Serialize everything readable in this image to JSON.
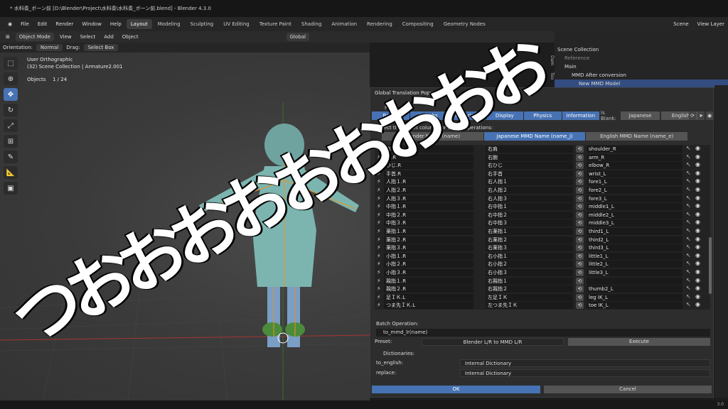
{
  "window": {
    "title": "* 水科奏_ボーン前 [D:\\Blender\\Project\\水科奏\\水科奏_ボーン前.blend] - Blender 4.3.0"
  },
  "menu": [
    "File",
    "Edit",
    "Render",
    "Window",
    "Help"
  ],
  "workspaces": [
    "Layout",
    "Modeling",
    "Sculpting",
    "UV Editing",
    "Texture Paint",
    "Shading",
    "Animation",
    "Rendering",
    "Compositing",
    "Geometry Nodes"
  ],
  "scene_label": "Scene",
  "view_layer": "View Layer",
  "header": {
    "mode": "Object Mode",
    "view": "View",
    "select": "Select",
    "add": "Add",
    "object": "Object",
    "transform": "Global"
  },
  "header2": {
    "orientation_label": "Orientation:",
    "orientation": "Normal",
    "drag_label": "Drag:",
    "drag": "Select Box"
  },
  "viewport": {
    "view_name": "User Orthographic",
    "collection": "(32) Scene Collection | Armature2.001",
    "objects_label": "Objects",
    "objects_count": "1 / 24"
  },
  "outliner": {
    "rows": [
      "Scene Collection",
      "Reference",
      "Main",
      "MMD After conversion",
      "New MMD Model"
    ]
  },
  "side_tabs": [
    "Dam",
    "Too"
  ],
  "popup": {
    "title": "Global Translation Popup",
    "filter_label": "Filter",
    "tabs": [
      "Bones",
      "Morphs",
      "Materials",
      "Display",
      "Physics",
      "Information"
    ],
    "is_blank_label": "Is Blank:",
    "blank_options": [
      "Japanese",
      "English"
    ],
    "select_target": "Select the target column for Batch Operations:",
    "columns": [
      "Blender Name (name)",
      "Japanese MMD Name (name_j)",
      "English MMD Name (name_e)"
    ],
    "bones": [
      {
        "name": "肩.R",
        "name_j": "右肩",
        "name_e": "shoulder_R"
      },
      {
        "name": "腕.R",
        "name_j": "右腕",
        "name_e": "arm_R"
      },
      {
        "name": "ひじ.R",
        "name_j": "右ひじ",
        "name_e": "elbow_R"
      },
      {
        "name": "手首.R",
        "name_j": "右手首",
        "name_e": "wrist_L"
      },
      {
        "name": "人指１.R",
        "name_j": "右人指１",
        "name_e": "fore1_L"
      },
      {
        "name": "人指２.R",
        "name_j": "右人指２",
        "name_e": "fore2_L"
      },
      {
        "name": "人指３.R",
        "name_j": "右人指３",
        "name_e": "fore3_L"
      },
      {
        "name": "中指１.R",
        "name_j": "右中指１",
        "name_e": "middle1_L"
      },
      {
        "name": "中指２.R",
        "name_j": "右中指２",
        "name_e": "middle2_L"
      },
      {
        "name": "中指３.R",
        "name_j": "右中指３",
        "name_e": "middle3_L"
      },
      {
        "name": "薬指１.R",
        "name_j": "右薬指１",
        "name_e": "third1_L"
      },
      {
        "name": "薬指２.R",
        "name_j": "右薬指２",
        "name_e": "third2_L"
      },
      {
        "name": "薬指３.R",
        "name_j": "右薬指３",
        "name_e": "third3_L"
      },
      {
        "name": "小指１.R",
        "name_j": "右小指１",
        "name_e": "little1_L"
      },
      {
        "name": "小指２.R",
        "name_j": "右小指２",
        "name_e": "little2_L"
      },
      {
        "name": "小指３.R",
        "name_j": "右小指３",
        "name_e": "little3_L"
      },
      {
        "name": "親指１.R",
        "name_j": "右親指１",
        "name_e": ""
      },
      {
        "name": "親指２.R",
        "name_j": "右親指２",
        "name_e": "thumb2_L"
      },
      {
        "name": "足ＩＫ.L",
        "name_j": "左足ＩＫ",
        "name_e": "leg IK_L"
      },
      {
        "name": "つま先ＩＫ.L",
        "name_j": "左つま先ＩＫ",
        "name_e": "toe IK_L"
      }
    ],
    "batch_label": "Batch Operation:",
    "batch_value": "to_mmd_lr(name)",
    "preset_label": "Preset:",
    "preset_value": "Blender L/R to MMD L/R",
    "execute": "Execute",
    "dict_label": "Dictionaries:",
    "to_english_label": "to_english:",
    "to_english_value": "Internal Dictionary",
    "replace_label": "replace:",
    "replace_value": "Internal Dictionary",
    "ok": "OK",
    "cancel": "Cancel"
  },
  "status_version": "3.0",
  "overlay_text": "つおおおおおおおおお"
}
